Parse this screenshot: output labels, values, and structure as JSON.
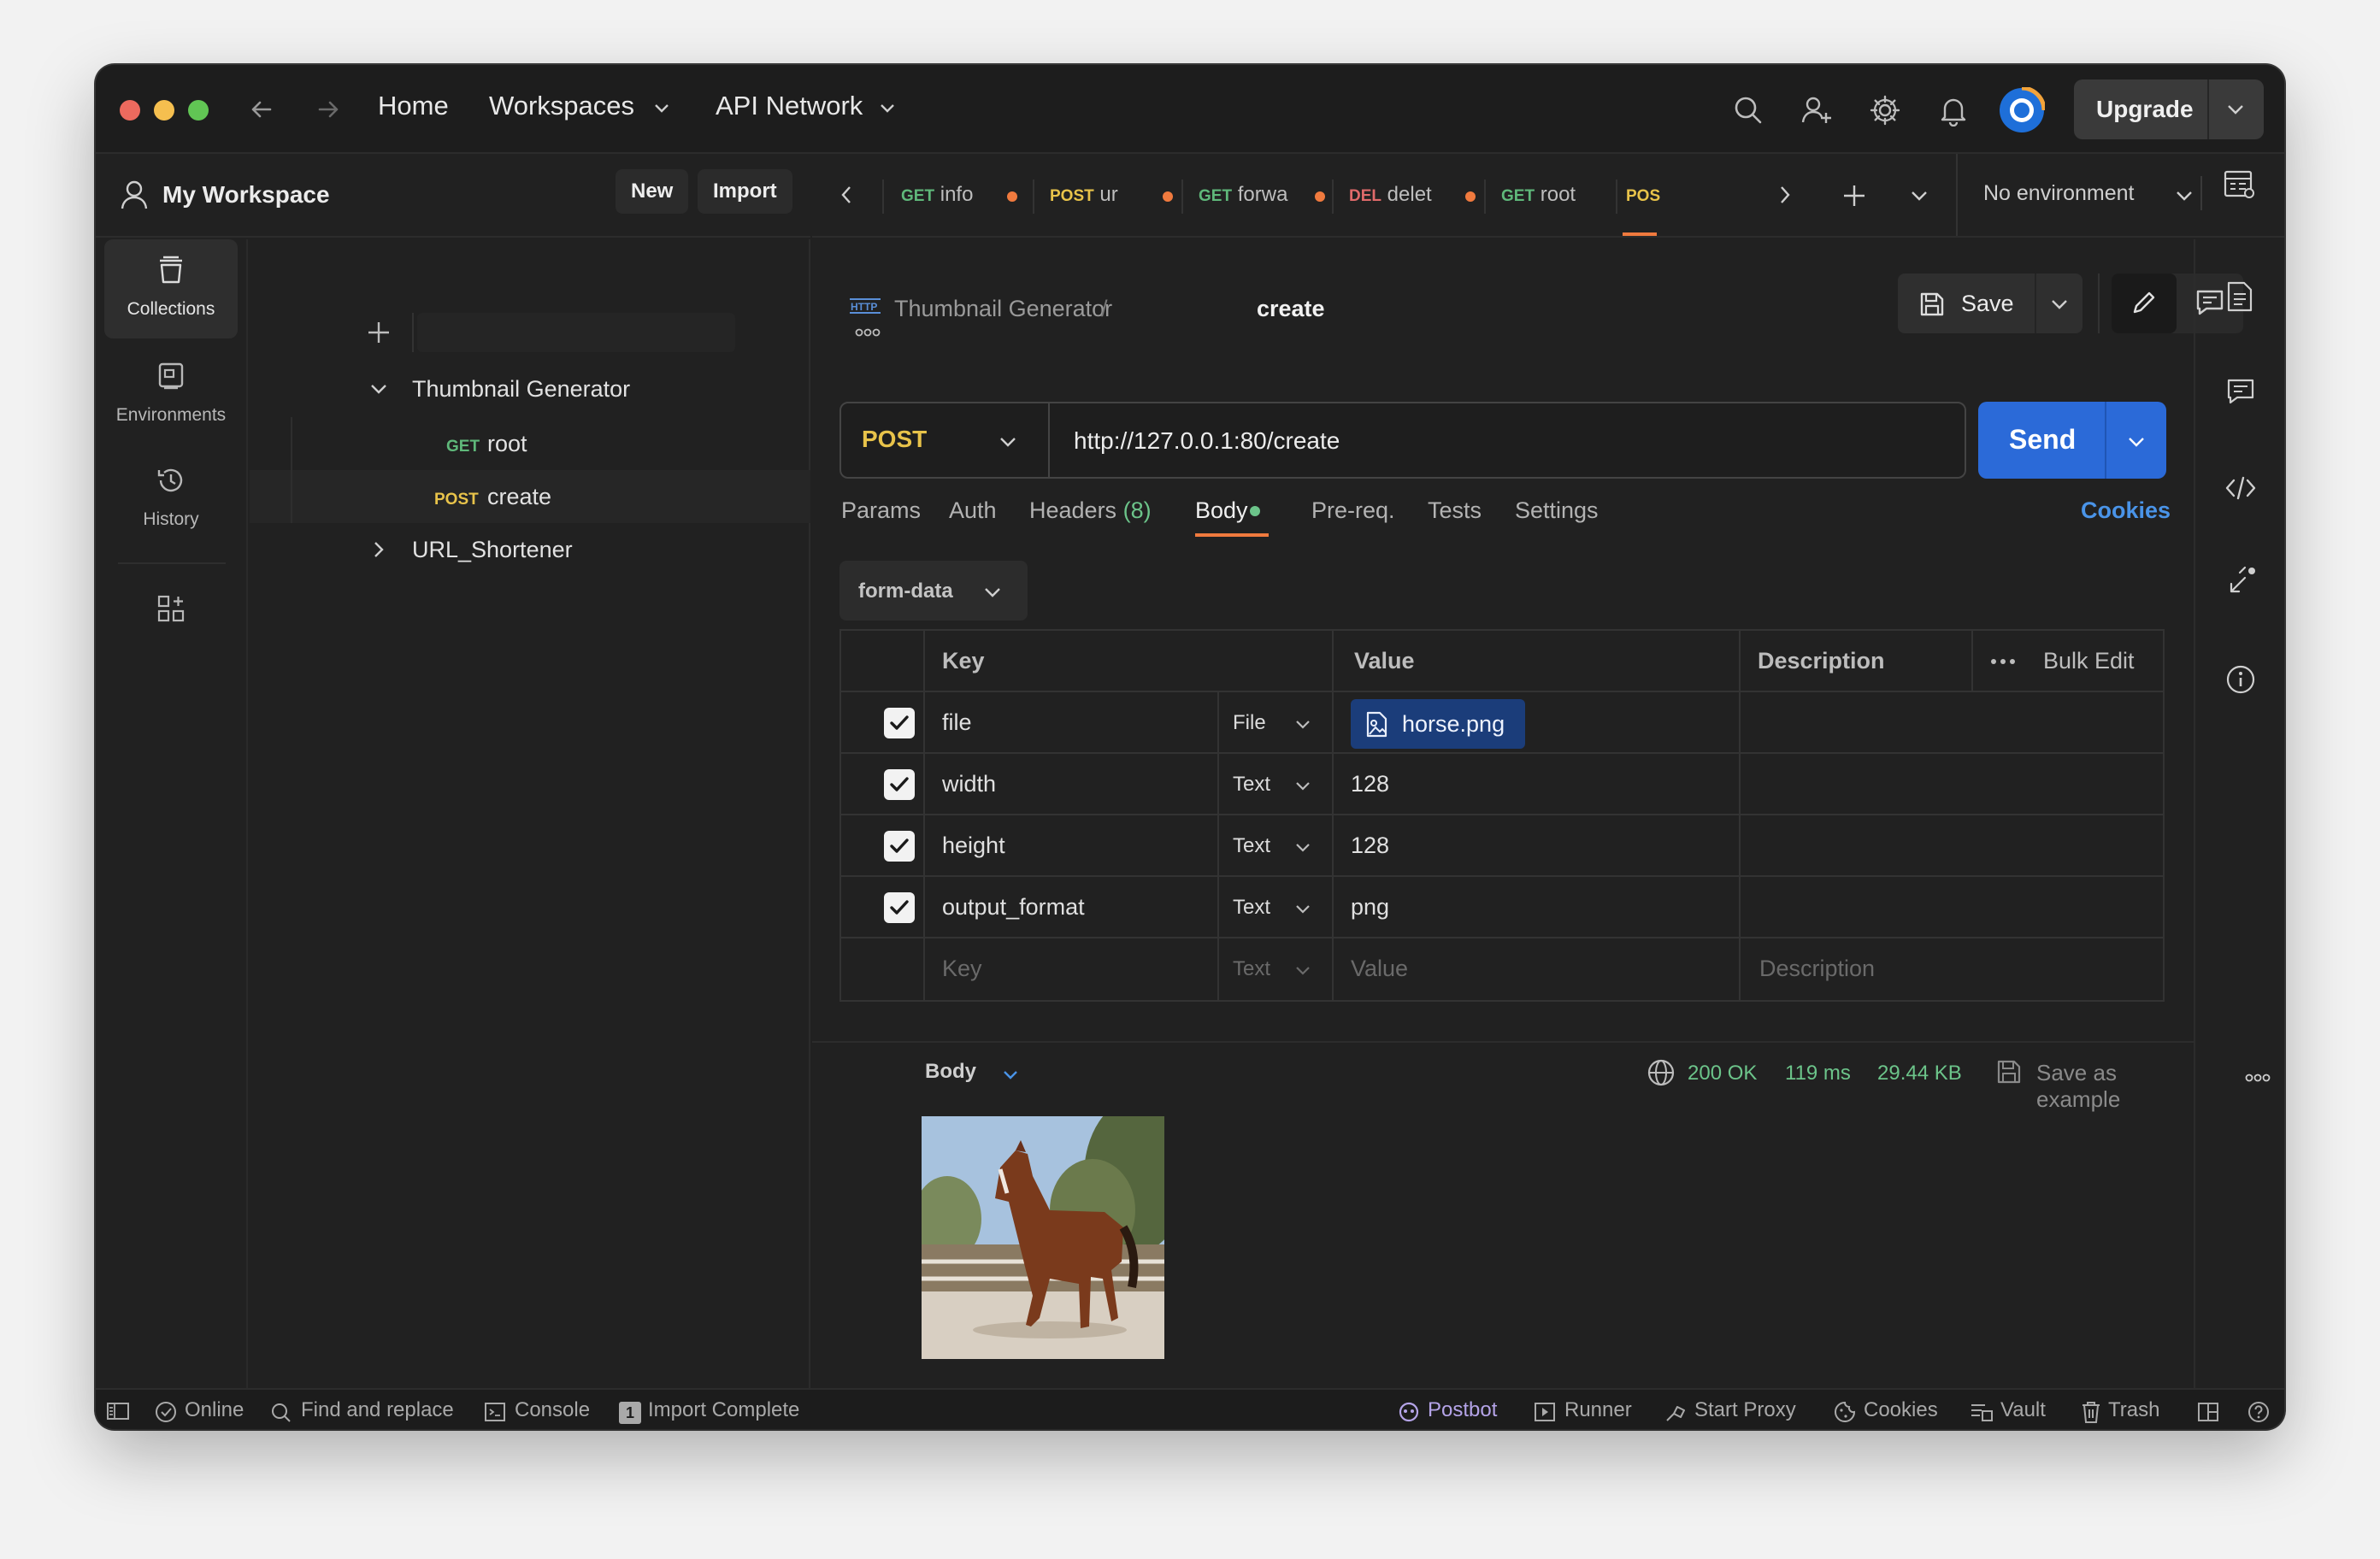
{
  "titlebar": {
    "nav": {
      "home": "Home",
      "workspaces": "Workspaces",
      "api_network": "API Network"
    },
    "upgrade_label": "Upgrade"
  },
  "workspace": {
    "title": "My Workspace",
    "new_label": "New",
    "import_label": "Import"
  },
  "rail": [
    {
      "label": "Collections",
      "icon": "collections-icon"
    },
    {
      "label": "Environments",
      "icon": "environments-icon"
    },
    {
      "label": "History",
      "icon": "history-icon"
    }
  ],
  "tree": {
    "collection_1": "Thumbnail Generator",
    "req_1_method": "GET",
    "req_1_name": "root",
    "req_2_method": "POST",
    "req_2_name": "create",
    "collection_2": "URL_Shortener"
  },
  "tabs": [
    {
      "method": "GET",
      "name": "info",
      "method_color": "#5fb87a"
    },
    {
      "method": "POST",
      "name": "ur",
      "method_color": "#e8c34a"
    },
    {
      "method": "GET",
      "name": "forwa",
      "method_color": "#5fb87a"
    },
    {
      "method": "DEL",
      "name": "delet",
      "method_color": "#e06a6a"
    },
    {
      "method": "GET",
      "name": "root",
      "method_color": "#5fb87a"
    },
    {
      "method": "POS",
      "name": "",
      "method_color": "#e8c34a"
    }
  ],
  "environment": "No environment",
  "breadcrumb": {
    "collection": "Thumbnail Generator",
    "separator": "/",
    "request": "create"
  },
  "save_label": "Save",
  "request": {
    "method": "POST",
    "url": "http://127.0.0.1:80/create",
    "send_label": "Send"
  },
  "subtabs": {
    "params": "Params",
    "auth": "Auth",
    "headers": "Headers",
    "headers_count": "(8)",
    "body": "Body",
    "prereq": "Pre-req.",
    "tests": "Tests",
    "settings": "Settings",
    "cookies": "Cookies"
  },
  "body_mode": "form-data",
  "table": {
    "headers": {
      "key": "Key",
      "value": "Value",
      "description": "Description",
      "bulk_edit": "Bulk Edit"
    },
    "rows": [
      {
        "key": "file",
        "type": "File",
        "value": "horse.png",
        "checked": true
      },
      {
        "key": "width",
        "type": "Text",
        "value": "128",
        "checked": true
      },
      {
        "key": "height",
        "type": "Text",
        "value": "128",
        "checked": true
      },
      {
        "key": "output_format",
        "type": "Text",
        "value": "png",
        "checked": true
      }
    ],
    "placeholder": {
      "key": "Key",
      "type": "Text",
      "value": "Value",
      "description": "Description"
    }
  },
  "response": {
    "section": "Body",
    "status": "200 OK",
    "time": "119 ms",
    "size": "29.44 KB",
    "save_example": "Save as example"
  },
  "statusbar": {
    "online": "Online",
    "find_replace": "Find and replace",
    "console": "Console",
    "import_badge": "1",
    "import_complete": "Import Complete",
    "postbot": "Postbot",
    "runner": "Runner",
    "start_proxy": "Start Proxy",
    "cookies": "Cookies",
    "vault": "Vault",
    "trash": "Trash"
  },
  "colors": {
    "accent_blue": "#2b6ad8",
    "get_green": "#5fb87a",
    "post_yellow": "#e8c34a",
    "delete_red": "#e06a6a",
    "status_green": "#6cc48a",
    "tab_active": "#f07a3e"
  }
}
